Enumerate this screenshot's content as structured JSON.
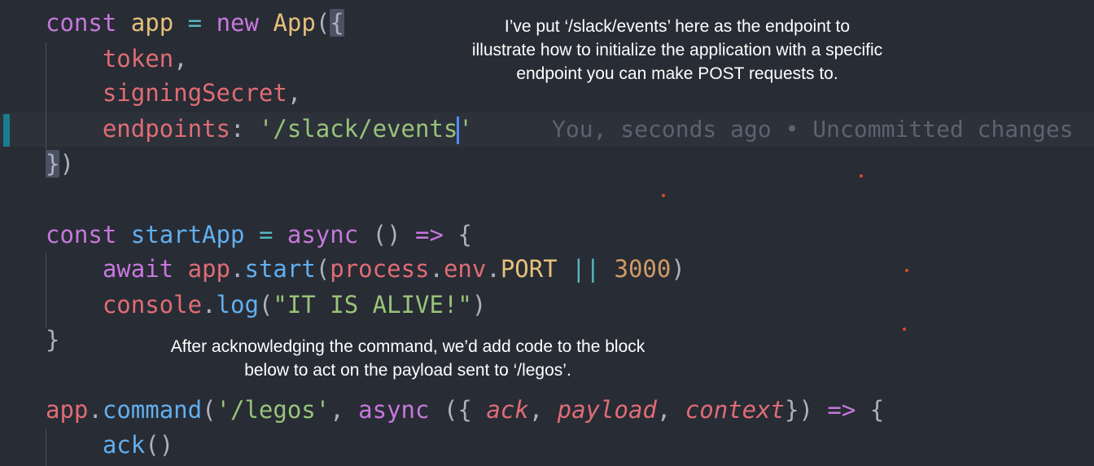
{
  "lines": {
    "l1": [
      "const",
      "app",
      "=",
      "new",
      "App",
      "(",
      "{"
    ],
    "l2": [
      "token",
      ","
    ],
    "l3": [
      "signingSecret",
      ","
    ],
    "l4": [
      "endpoints",
      ": ",
      "'/slack/events",
      "'"
    ],
    "l5": [
      "}",
      ")"
    ],
    "l7": [
      "const",
      "startApp",
      "=",
      "async",
      "() ",
      "=>",
      "{"
    ],
    "l8": [
      "await",
      "app",
      ".",
      "start",
      "(",
      "process",
      ".",
      "env",
      ".",
      "PORT",
      "||",
      "3000",
      ")"
    ],
    "l9": [
      "console",
      ".",
      "log",
      "(",
      "\"IT IS ALIVE!\"",
      ")"
    ],
    "l10": [
      "}"
    ],
    "l12": [
      "app",
      ".",
      "command",
      "(",
      "'/legos'",
      ", ",
      "async",
      "({",
      "ack",
      ", ",
      "payload",
      ", ",
      "context",
      "})",
      "=>",
      "{"
    ],
    "l13": [
      "ack",
      "()"
    ]
  },
  "blame": "You, seconds ago • Uncommitted changes",
  "annotations": {
    "top": "I’ve put ‘/slack/events’ here as the endpoint to illustrate how to initialize the application with a specific endpoint you can make POST requests to.",
    "middle": "After acknowledging the command, we’d add code to the block below to act on the payload sent to ‘/legos’."
  },
  "colors": {
    "background": "#282c34",
    "keyword": "#c678dd",
    "variable": "#e06c75",
    "class": "#e5c07b",
    "function": "#61afef",
    "string": "#98c379",
    "number": "#d19a66",
    "operator": "#56b6c2",
    "gutter_modified": "#1b7c8f"
  }
}
